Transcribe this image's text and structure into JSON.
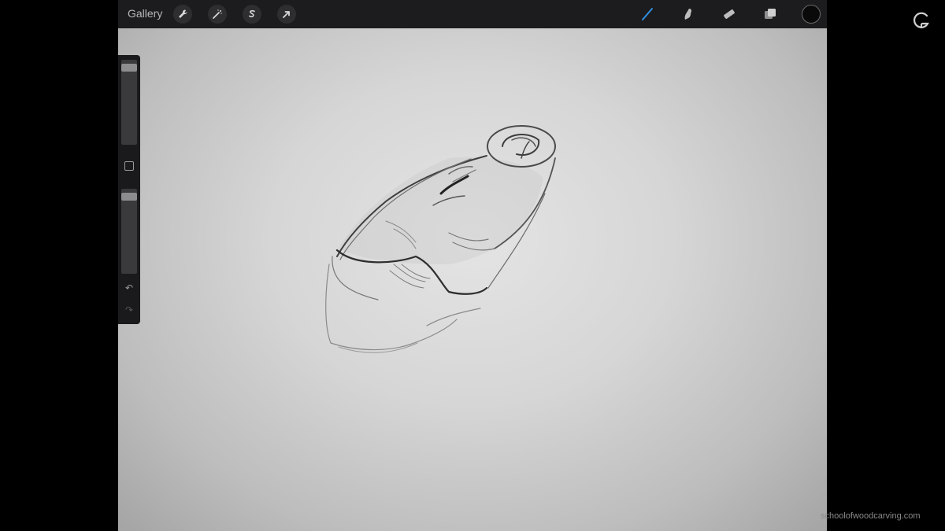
{
  "toolbar": {
    "gallery_label": "Gallery",
    "left_tools": [
      "wrench-icon",
      "magic-wand-icon",
      "selection-s-icon",
      "arrow-transform-icon"
    ],
    "right_tools": [
      "brush-icon",
      "smudge-icon",
      "eraser-icon",
      "layers-icon"
    ],
    "active_tool": "brush-icon",
    "accent_color": "#2f8fe0",
    "current_color": "#0a0a0a"
  },
  "sidebar": {
    "brush_size_level": 0.05,
    "opacity_level": 0.05,
    "undo_symbol": "↶",
    "redo_symbol": "↷"
  },
  "watermark": {
    "text": "schoolofwoodcarving.com"
  }
}
